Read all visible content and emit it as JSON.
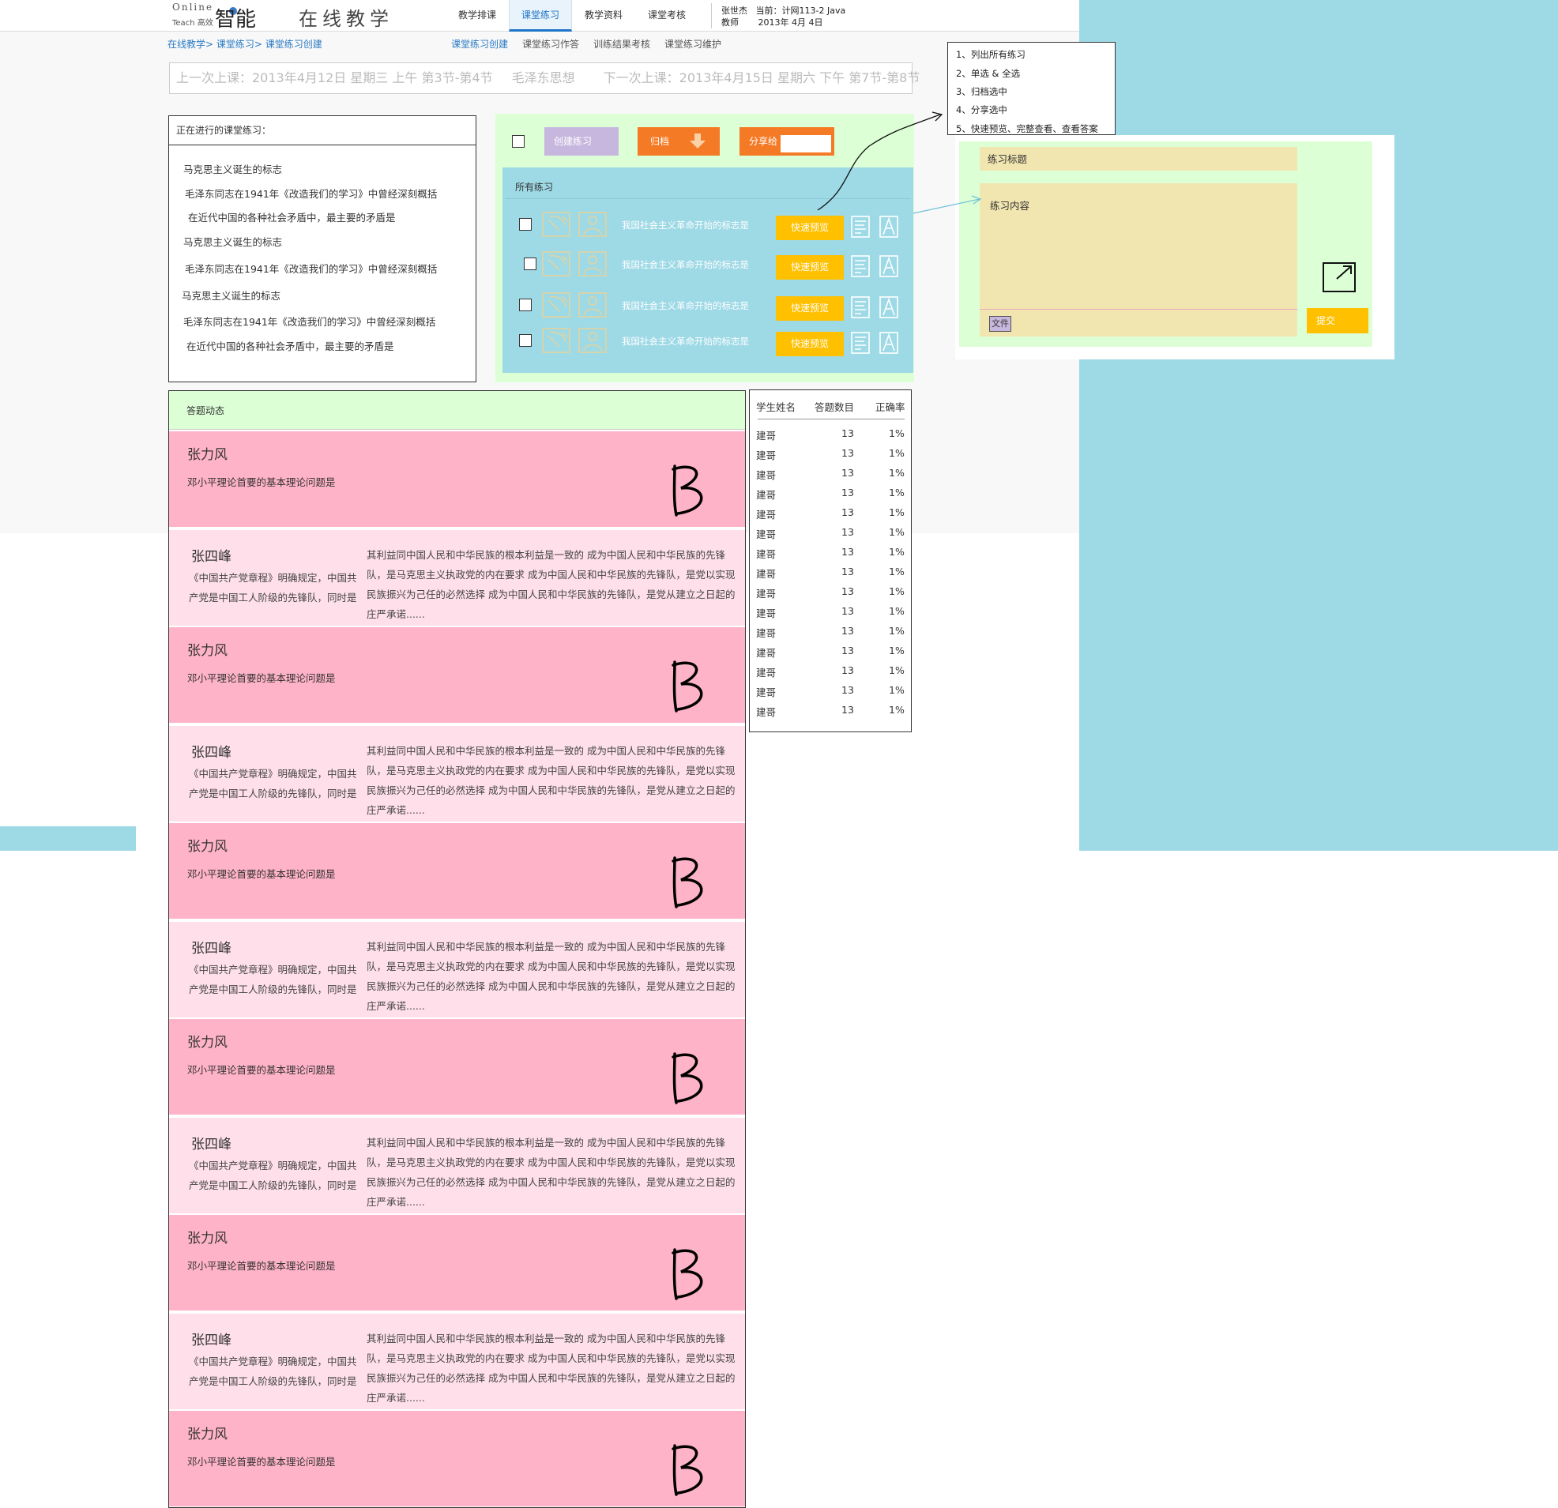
{
  "brand": {
    "online": "Online",
    "teach": "Teach 高效",
    "name": "智能",
    "title": "在线教学"
  },
  "nav": [
    "教学排课",
    "课堂练习",
    "教学资料",
    "课堂考核"
  ],
  "user": {
    "name": "张世杰",
    "role": "教师",
    "current_label": "当前：计网113-2 Java",
    "date": "2013年 4月 4日"
  },
  "breadcrumb": {
    "a": "在线教学>",
    "b": "课堂练习>",
    "c": "课堂练习创建"
  },
  "subnav": [
    "课堂练习创建",
    "课堂练习作答",
    "训练结果考核",
    "课堂练习维护"
  ],
  "lesson": {
    "prev": "上一次上课：2013年4月12日 星期三 上午 第3节-第4节",
    "course": "毛泽东思想",
    "next": "下一次上课：2013年4月15日 星期六 下午 第7节-第8节"
  },
  "ongoing": {
    "title": "正在进行的课堂练习：",
    "items": [
      "马克思主义诞生的标志",
      "毛泽东同志在1941年《改造我们的学习》中曾经深刻概括",
      "在近代中国的各种社会矛盾中，最主要的矛盾是",
      "马克思主义诞生的标志",
      "毛泽东同志在1941年《改造我们的学习》中曾经深刻概括",
      "马克思主义诞生的标志",
      "毛泽东同志在1941年《改造我们的学习》中曾经深刻概括",
      "在近代中国的各种社会矛盾中，最主要的矛盾是"
    ]
  },
  "toolbar": {
    "create": "创建练习",
    "archive": "归档",
    "share": "分享给"
  },
  "all_exercises": {
    "title": "所有练习",
    "rows": [
      {
        "title": "我国社会主义革命开始的标志是",
        "button": "快速预览"
      },
      {
        "title": "我国社会主义革命开始的标志是",
        "button": "快速预览"
      },
      {
        "title": "我国社会主义革命开始的标志是",
        "button": "快速预览"
      },
      {
        "title": "我国社会主义革命开始的标志是",
        "button": "快速预览"
      }
    ]
  },
  "feed": {
    "title": "答题动态",
    "card_a": {
      "name": "张力风",
      "question": "邓小平理论首要的基本理论问题是",
      "grade": "B"
    },
    "card_b": {
      "name": "张四峰",
      "side": "《中国共产党章程》明确规定，中国共产党是中国工人阶级的先锋队，同时是中国人民和中华民族的先锋队",
      "text": "其利益同中国人民和中华民族的根本利益是一致的 成为中国人民和中华民族的先锋队，是马克思主义执政党的内在要求 成为中国人民和中华民族的先锋队，是党以实现民族振兴为己任的必然选择 成为中国人民和中华民族的先锋队，是党从建立之日起的庄严承诺......"
    }
  },
  "stats": {
    "headers": [
      "学生姓名",
      "答题数目",
      "正确率"
    ],
    "rows": [
      [
        "建哥",
        "13",
        "1%"
      ],
      [
        "建哥",
        "13",
        "1%"
      ],
      [
        "建哥",
        "13",
        "1%"
      ],
      [
        "建哥",
        "13",
        "1%"
      ],
      [
        "建哥",
        "13",
        "1%"
      ],
      [
        "建哥",
        "13",
        "1%"
      ],
      [
        "建哥",
        "13",
        "1%"
      ],
      [
        "建哥",
        "13",
        "1%"
      ],
      [
        "建哥",
        "13",
        "1%"
      ],
      [
        "建哥",
        "13",
        "1%"
      ],
      [
        "建哥",
        "13",
        "1%"
      ],
      [
        "建哥",
        "13",
        "1%"
      ],
      [
        "建哥",
        "13",
        "1%"
      ],
      [
        "建哥",
        "13",
        "1%"
      ],
      [
        "建哥",
        "13",
        "1%"
      ]
    ]
  },
  "notes": [
    "1、列出所有练习",
    "2、单选 & 全选",
    "3、归档选中",
    "4、分享选中",
    "5、快速预览、完整查看、查看答案"
  ],
  "form": {
    "title_label": "练习标题",
    "content_label": "练习内容",
    "file": "文件",
    "submit": "提交"
  },
  "colors": {
    "accent_blue": "#1e74c6",
    "orange": "#f57a25",
    "yellow": "#ffc000",
    "pink": "#ffb3c9",
    "light_pink": "#ffe0ea",
    "sky": "#9ed9e6",
    "mint": "#dcffd6"
  }
}
